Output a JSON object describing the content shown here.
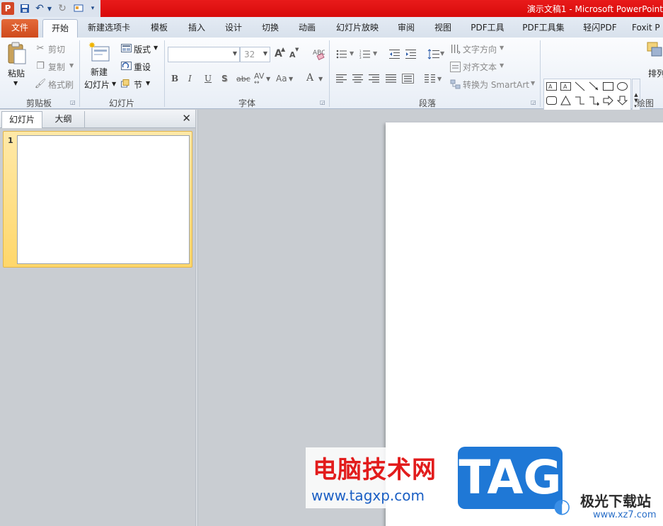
{
  "app": {
    "title": "演示文稿1  -  Microsoft PowerPoint",
    "logo": "P"
  },
  "tabs": [
    {
      "label": "文件"
    },
    {
      "label": "开始"
    },
    {
      "label": "新建选项卡"
    },
    {
      "label": "模板"
    },
    {
      "label": "插入"
    },
    {
      "label": "设计"
    },
    {
      "label": "切换"
    },
    {
      "label": "动画"
    },
    {
      "label": "幻灯片放映"
    },
    {
      "label": "审阅"
    },
    {
      "label": "视图"
    },
    {
      "label": "PDF工具"
    },
    {
      "label": "PDF工具集"
    },
    {
      "label": "轻闪PDF"
    },
    {
      "label": "Foxit P"
    }
  ],
  "ribbon": {
    "clipboard": {
      "label": "剪贴板",
      "paste": "粘贴",
      "cut": "剪切",
      "copy": "复制",
      "format_painter": "格式刷"
    },
    "slides": {
      "label": "幻灯片",
      "new_slide_1": "新建",
      "new_slide_2": "幻灯片",
      "layout": "版式",
      "reset": "重设",
      "section": "节"
    },
    "font": {
      "label": "字体",
      "font_name": "",
      "font_size": "32",
      "bold": "B",
      "italic": "I",
      "underline": "U",
      "shadow": "S",
      "strike": "abc",
      "spacing": "AV",
      "case": "Aa",
      "color": "A",
      "grow": "A",
      "shrink": "A"
    },
    "paragraph": {
      "label": "段落",
      "text_direction": "文字方向",
      "align_text": "对齐文本",
      "smartart": "转换为 SmartArt"
    },
    "drawing": {
      "label": "绘图",
      "arrange": "排列"
    }
  },
  "pane": {
    "tab_slides": "幻灯片",
    "tab_outline": "大纲",
    "close": "✕",
    "slide_number": "1"
  },
  "watermark": {
    "title": "电脑技术网",
    "url": "www.tagxp.com",
    "tag": "TAG",
    "site2_name": "极光下载站",
    "site2_url": "www.xz7.com"
  }
}
